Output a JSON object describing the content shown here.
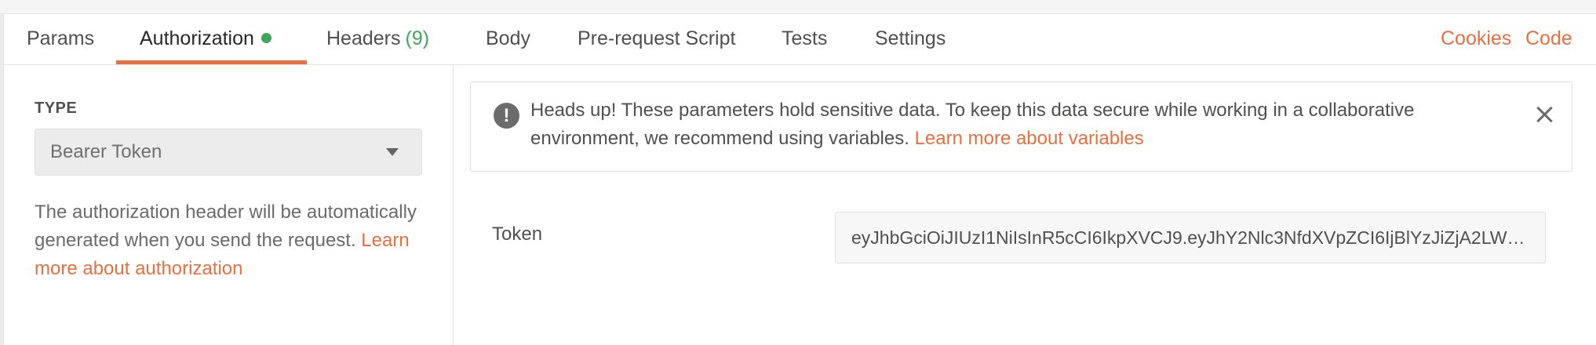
{
  "tabs": [
    {
      "label": "Params"
    },
    {
      "label": "Authorization"
    },
    {
      "label": "Headers",
      "count": "(9)"
    },
    {
      "label": "Body"
    },
    {
      "label": "Pre-request Script"
    },
    {
      "label": "Tests"
    },
    {
      "label": "Settings"
    }
  ],
  "active_tab": "Authorization",
  "right_links": {
    "cookies": "Cookies",
    "code": "Code"
  },
  "auth": {
    "type_label": "TYPE",
    "type_value": "Bearer Token",
    "help_text": "The authorization header will be automatically generated when you send the request. ",
    "help_link": "Learn more about authorization"
  },
  "alert": {
    "text": "Heads up! These parameters hold sensitive data. To keep this data secure while working in a collaborative environment, we recommend using variables. ",
    "link": "Learn more about variables",
    "icon": "!"
  },
  "token": {
    "label": "Token",
    "value": "eyJhbGciOiJIUzI1NiIsInR5cCI6IkpXVCJ9.eyJhY2Nlc3NfdXVpZCI6IjBlYzJiZjA2LW…"
  },
  "colors": {
    "accent": "#e8703f",
    "status_green": "#3fa55b"
  }
}
